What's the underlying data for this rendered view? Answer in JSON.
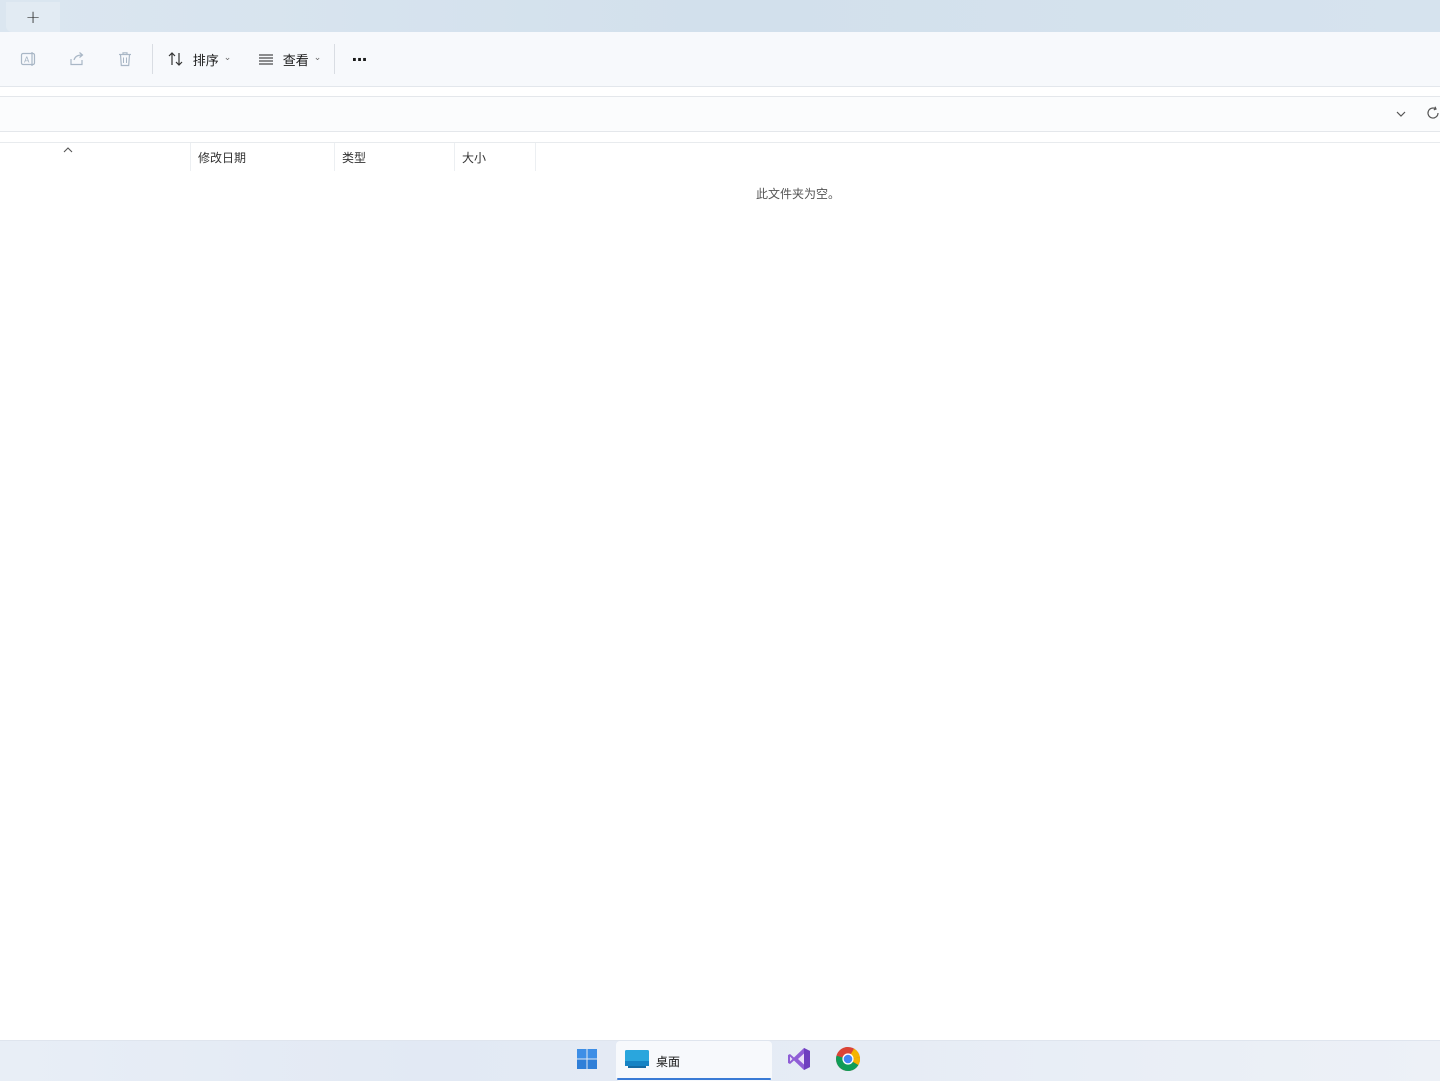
{
  "tabbar": {
    "new_tab_symbol": "+"
  },
  "toolbar": {
    "rename_icon": "rename-icon",
    "share_icon": "share-icon",
    "delete_icon": "delete-icon",
    "sort_label": "排序",
    "view_label": "查看",
    "more_symbol": "···"
  },
  "columns": [
    {
      "label": "修改日期"
    },
    {
      "label": "类型"
    },
    {
      "label": "大小"
    }
  ],
  "content": {
    "empty_message": "此文件夹为空。"
  },
  "taskbar": {
    "active_window_label": "桌面"
  },
  "colors": {
    "accent": "#3a7bd5",
    "toolbar_bg": "#f7f9fc",
    "tabbar_bg": "#d6e3ee"
  }
}
